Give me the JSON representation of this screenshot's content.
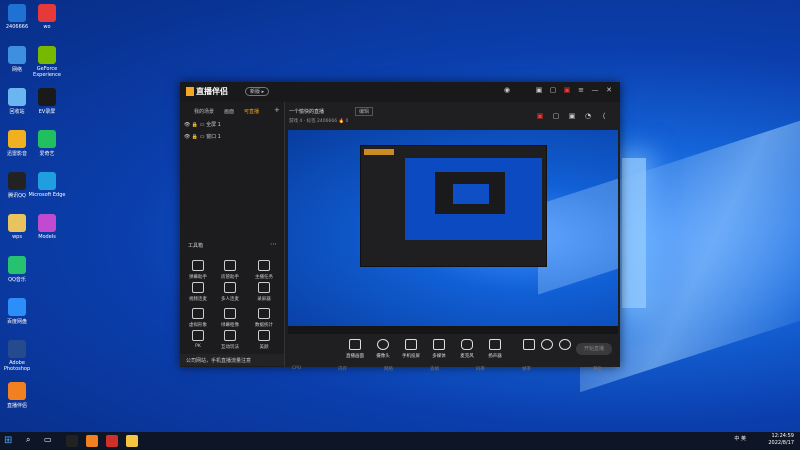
{
  "desktop": {
    "icons": [
      {
        "label": "2406666",
        "color": "#1f72d4"
      },
      {
        "label": "网络",
        "color": "#3d8fe0"
      },
      {
        "label": "回收站",
        "color": "#6bb6f0"
      },
      {
        "label": "迅雷影音",
        "color": "#f0b020"
      },
      {
        "label": "腾讯QQ",
        "color": "#222222"
      },
      {
        "label": "wps",
        "color": "#e8c460"
      },
      {
        "label": "QQ音乐",
        "color": "#27c26f"
      },
      {
        "label": "百度网盘",
        "color": "#2c8ef8"
      },
      {
        "label": "Adobe Photoshop",
        "color": "#264a8e"
      },
      {
        "label": "直播伴侣",
        "color": "#f08020"
      }
    ],
    "icons_col2": [
      {
        "label": "wo",
        "color": "#e63a3a"
      },
      {
        "label": "GeForce Experience",
        "color": "#76b900"
      },
      {
        "label": "EV录屏",
        "color": "#1a1a1a"
      },
      {
        "label": "爱奇艺",
        "color": "#20c060"
      },
      {
        "label": "Microsoft Edge",
        "color": "#1f9fe0"
      },
      {
        "label": "Models",
        "color": "#c04ad0"
      }
    ]
  },
  "app": {
    "brand": "直播伴侣",
    "version": "新版 ▸",
    "tabs": [
      "我的场景",
      "画面",
      "可直播"
    ],
    "sources": [
      "全屏 1",
      "窗口 1"
    ],
    "stream_title": "一个愉快的直播",
    "edit_label": "编辑",
    "tags": [
      "游戏 4",
      "标签",
      "2406666",
      "0"
    ],
    "tools_title": "工具箱",
    "tools": [
      "弹幕助手",
      "房管助手",
      "主播任务",
      "视频连麦",
      "多人连麦",
      "录屏器",
      "虚拟形象",
      "绿幕抠像",
      "数据统计",
      "PK",
      "互动玩法",
      "美颜"
    ],
    "notice": "公司网站，手机直播流量注意",
    "bottom_buttons": [
      "直播画面",
      "摄像头",
      "手机投屏",
      "多媒体",
      "麦克风",
      "扬声器"
    ],
    "go_live": "开始直播",
    "status_items": [
      "CPU",
      "内存",
      "网络",
      "丢帧",
      "码率",
      "帧率",
      "开启"
    ]
  },
  "taskbar": {
    "time": "12:24:59",
    "date": "2022/8/17",
    "tray": "中 英"
  }
}
